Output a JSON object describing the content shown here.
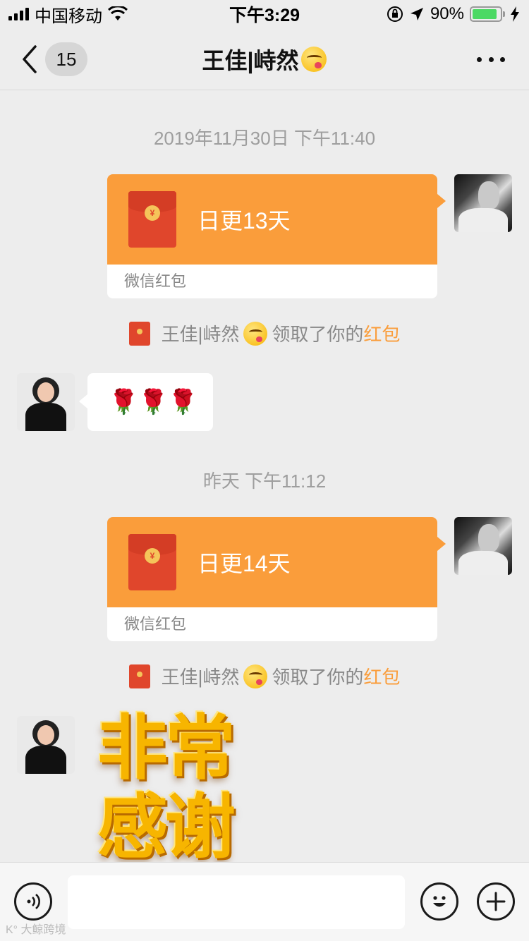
{
  "status_bar": {
    "carrier": "中国移动",
    "time": "下午3:29",
    "battery": "90%",
    "battery_level": 0.9
  },
  "nav": {
    "unread_count": "15",
    "title": "王佳|峙然",
    "title_emoji": "savoring-food-emoji"
  },
  "messages": [
    {
      "type": "timestamp",
      "text": "2019年11月30日 下午11:40"
    },
    {
      "type": "red_packet",
      "sender": "self",
      "title": "日更13天",
      "footer": "微信红包"
    },
    {
      "type": "system",
      "name": "王佳|峙然",
      "action": "领取了你的",
      "link": "红包"
    },
    {
      "type": "text",
      "sender": "other",
      "content": "roses",
      "count": 3
    },
    {
      "type": "timestamp",
      "text": "昨天 下午11:12"
    },
    {
      "type": "red_packet",
      "sender": "self",
      "title": "日更14天",
      "footer": "微信红包"
    },
    {
      "type": "system",
      "name": "王佳|峙然",
      "action": "领取了你的",
      "link": "红包"
    },
    {
      "type": "sticker",
      "sender": "other",
      "lines": [
        "非常",
        "感谢"
      ]
    }
  ],
  "input_bar": {
    "placeholder": "",
    "icons": [
      "voice-icon",
      "emoji-icon",
      "plus-icon"
    ]
  },
  "watermark": "大鲸跨境",
  "colors": {
    "packet_orange": "#fa9d3b",
    "packet_red": "#e0462c",
    "link_orange": "#fa9d3b",
    "battery_green": "#4cd964"
  }
}
